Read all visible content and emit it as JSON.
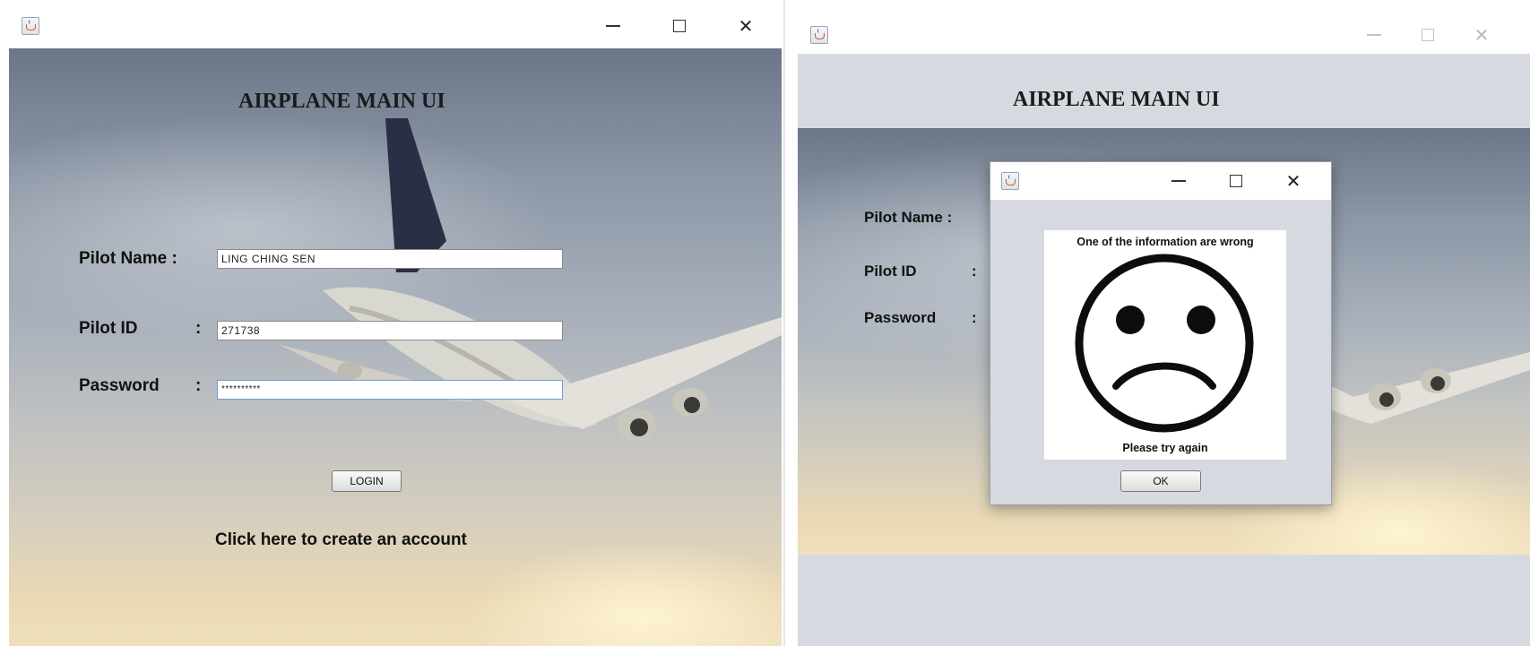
{
  "left_window": {
    "title_icon": "java-icon",
    "controls": [
      "minimize-icon",
      "maximize-icon",
      "close-icon"
    ],
    "close_glyph": "✕",
    "heading": "AIRPLANE MAIN UI",
    "pilot_name_label": "Pilot Name :",
    "pilot_name_value": "LING CHING SEN",
    "pilot_id_label": "Pilot ID",
    "pilot_id_colon": ":",
    "pilot_id_value": "271738",
    "password_label": "Password",
    "password_colon": ":",
    "password_value": "**********",
    "login_button": "LOGIN",
    "create_account_link": "Click here to create an account"
  },
  "right_window": {
    "title_icon": "java-icon",
    "controls": [
      "minimize-icon",
      "maximize-icon",
      "close-icon"
    ],
    "close_glyph": "✕",
    "heading": "AIRPLANE MAIN UI",
    "pilot_name_label": "Pilot Name :",
    "pilot_id_label": "Pilot ID",
    "pilot_id_colon": ":",
    "password_label": "Password",
    "password_colon": ":"
  },
  "error_dialog": {
    "title_icon": "java-icon",
    "controls": [
      "minimize-icon",
      "maximize-icon",
      "close-icon"
    ],
    "close_glyph": "✕",
    "message_top": "One of the information are wrong",
    "image_icon": "sad-face-icon",
    "message_bottom": "Please try again",
    "ok_button": "OK"
  }
}
